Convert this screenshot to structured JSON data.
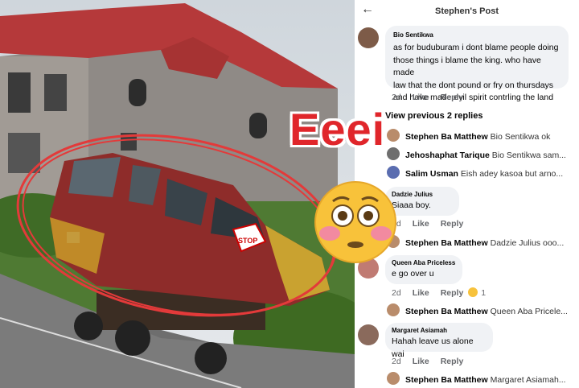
{
  "header": {
    "title": "Stephen's Post",
    "back_icon": "back-arrow-icon"
  },
  "overlay": {
    "text": "Eeei",
    "emoji": "flushed-face-emoji"
  },
  "comments": [
    {
      "name": "Bio Sentikwa",
      "text_lines": [
        "as for buduburam i dont blame people doing",
        "those things i blame the king. who have made",
        "law that the dont pound or fry on thursdays",
        "and have made evil spirit contrling the land"
      ],
      "time": "2d",
      "like": "Like",
      "reply": "Reply"
    },
    {
      "view_previous": "View previous 2 replies"
    },
    {
      "name": "Stephen Ba Matthew",
      "text": "Bio Sentikwa ok"
    },
    {
      "name": "Jehoshaphat Tarique",
      "text": "Bio Sentikwa sam..."
    },
    {
      "name": "Salim Usman",
      "text": "Eish adey kasoa but arno..."
    },
    {
      "name": "Dadzie Julius",
      "text": "Siaaa boy.",
      "time": "2d",
      "like": "Like",
      "reply": "Reply"
    },
    {
      "name": "Stephen Ba Matthew",
      "text": "Dadzie Julius ooo..."
    },
    {
      "name": "Queen Aba Priceless",
      "text": "e go over u",
      "time": "2d",
      "like": "Like",
      "reply": "Reply",
      "reaction_count": "1"
    },
    {
      "name": "Stephen Ba Matthew",
      "text": "Queen Aba Pricele..."
    },
    {
      "name": "Margaret Asiamah",
      "text": "Hahah leave us alone wai",
      "time": "2d",
      "like": "Like",
      "reply": "Reply"
    },
    {
      "name": "Stephen Ba Matthew",
      "text": "Margaret Asiamah..."
    }
  ]
}
